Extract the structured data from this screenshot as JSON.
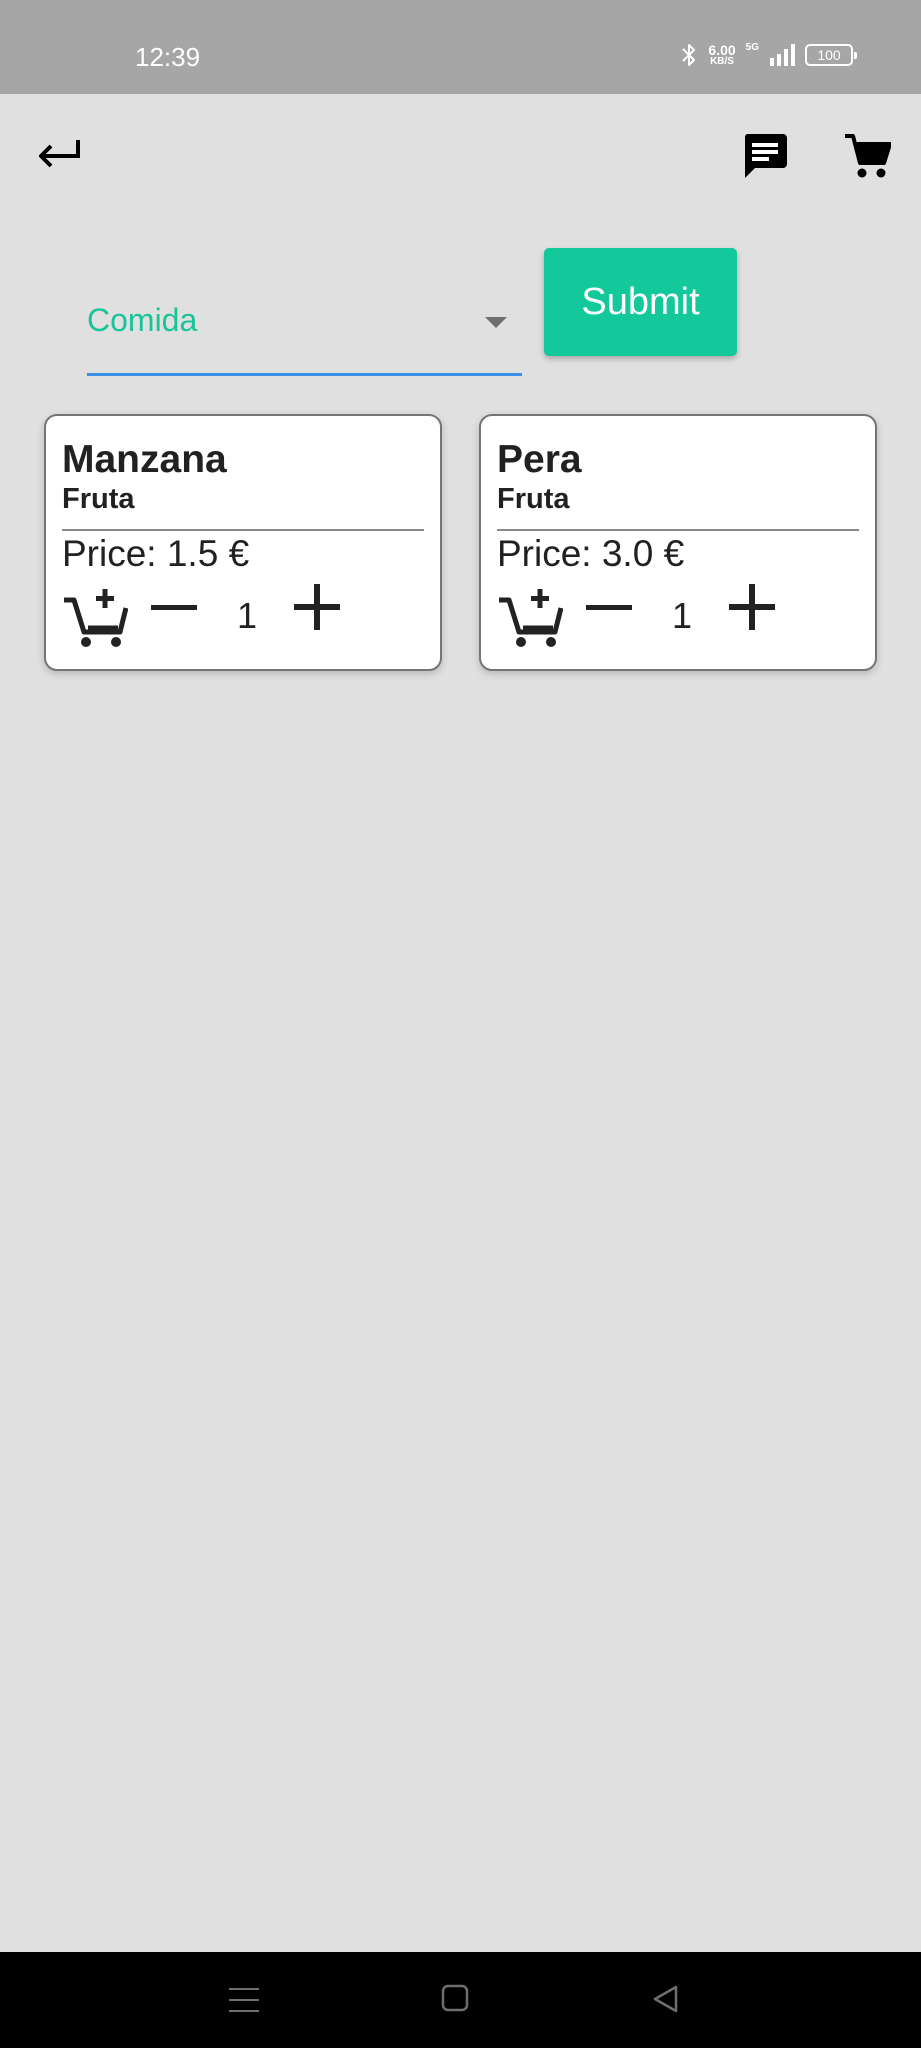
{
  "status_bar": {
    "time": "12:39",
    "net_speed_value": "6.00",
    "net_speed_unit": "KB/S",
    "network_type": "5G",
    "battery_level": "100",
    "icons": [
      "bluetooth-icon",
      "signal-icon",
      "battery-icon"
    ]
  },
  "app_bar": {
    "icons": [
      "back-arrow-icon",
      "chat-icon",
      "cart-icon"
    ]
  },
  "filter": {
    "selected_category": "Comida",
    "submit_label": "Submit"
  },
  "products": [
    {
      "name": "Manzana",
      "category": "Fruta",
      "price": "Price: 1.5 €",
      "quantity": "1"
    },
    {
      "name": "Pera",
      "category": "Fruta",
      "price": "Price: 3.0 €",
      "quantity": "1"
    }
  ],
  "colors": {
    "accent": "#13c89a",
    "select_text": "#18c59a",
    "select_underline": "#3b8fe6",
    "background": "#e0e0e0",
    "status_bar": "#a6a6a6"
  },
  "nav_bar": {
    "icons": [
      "menu-icon",
      "home-icon",
      "back-icon"
    ]
  }
}
